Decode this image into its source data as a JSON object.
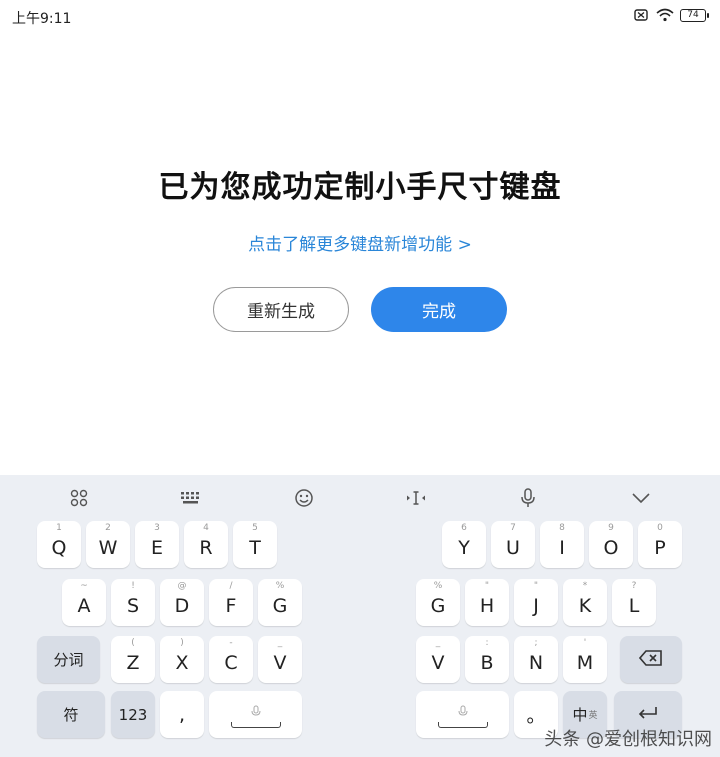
{
  "status_bar": {
    "time": "上午9:11",
    "battery_level": "74",
    "icons": [
      "no-sim-icon",
      "wifi-icon",
      "battery-icon"
    ]
  },
  "main": {
    "headline": "已为您成功定制小手尺寸键盘",
    "learn_link": "点击了解更多键盘新增功能 >",
    "regenerate_label": "重新生成",
    "done_label": "完成",
    "accent_color": "#2e86ea"
  },
  "keyboard": {
    "toolbar": [
      "apps-grid-icon",
      "keyboard-layout-icon",
      "emoji-icon",
      "cursor-move-icon",
      "voice-mic-icon",
      "collapse-chevron-icon"
    ],
    "row1_left": [
      {
        "hint": "1",
        "label": "Q"
      },
      {
        "hint": "2",
        "label": "W"
      },
      {
        "hint": "3",
        "label": "E"
      },
      {
        "hint": "4",
        "label": "R"
      },
      {
        "hint": "5",
        "label": "T"
      }
    ],
    "row1_right": [
      {
        "hint": "6",
        "label": "Y"
      },
      {
        "hint": "7",
        "label": "U"
      },
      {
        "hint": "8",
        "label": "I"
      },
      {
        "hint": "9",
        "label": "O"
      },
      {
        "hint": "0",
        "label": "P"
      }
    ],
    "row2_left": [
      {
        "hint": "~",
        "label": "A"
      },
      {
        "hint": "!",
        "label": "S"
      },
      {
        "hint": "@",
        "label": "D"
      },
      {
        "hint": "/",
        "label": "F"
      },
      {
        "hint": "%",
        "label": "G"
      }
    ],
    "row2_right": [
      {
        "hint": "%",
        "label": "G"
      },
      {
        "hint": "\"",
        "label": "H"
      },
      {
        "hint": "\"",
        "label": "J"
      },
      {
        "hint": "*",
        "label": "K"
      },
      {
        "hint": "?",
        "label": "L"
      }
    ],
    "row3_left": [
      {
        "hint": "",
        "label": "分词"
      },
      {
        "hint": "(",
        "label": "Z"
      },
      {
        "hint": ")",
        "label": "X"
      },
      {
        "hint": "-",
        "label": "C"
      },
      {
        "hint": "_",
        "label": "V"
      }
    ],
    "row3_right": [
      {
        "hint": "_",
        "label": "V"
      },
      {
        "hint": ":",
        "label": "B"
      },
      {
        "hint": ";",
        "label": "N"
      },
      {
        "hint": "'",
        "label": "M"
      }
    ],
    "row4": {
      "symbol_label": "符",
      "number_label": "123",
      "comma_label": ",",
      "period_label": "。",
      "lang_label": "中",
      "lang_sub": "英"
    }
  },
  "watermark": {
    "text": "头条 @爱创根知识网"
  }
}
